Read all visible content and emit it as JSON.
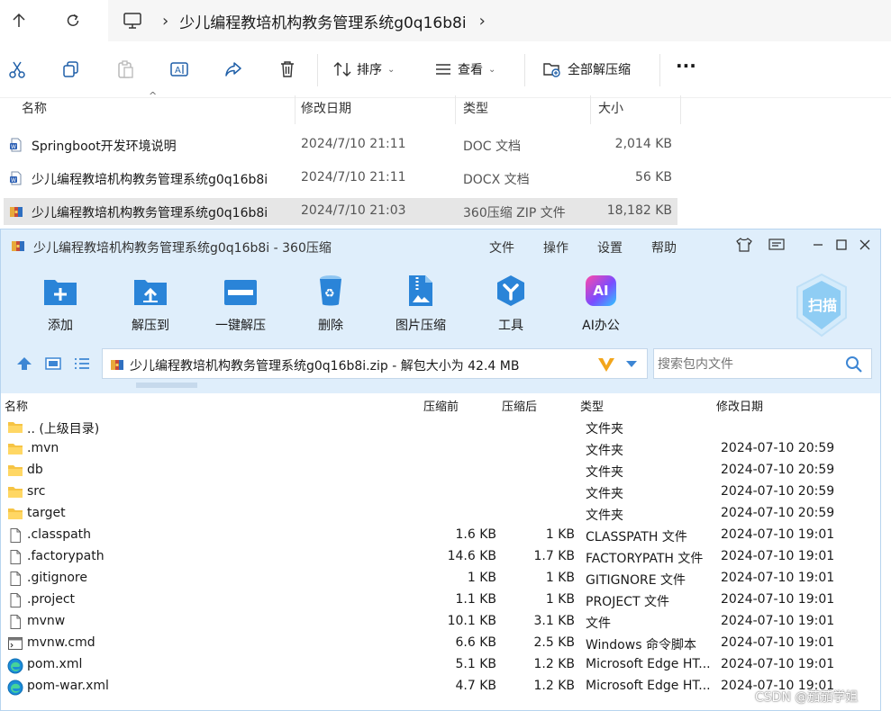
{
  "explorer": {
    "breadcrumb": "少儿编程教培机构教务管理系统g0q16b8i",
    "toolbar": {
      "sort_label": "排序",
      "view_label": "查看",
      "extract_all_label": "全部解压缩",
      "more_label": "···"
    },
    "columns": {
      "name": "名称",
      "date": "修改日期",
      "type": "类型",
      "size": "大小"
    },
    "files": [
      {
        "name": "Springboot开发环境说明",
        "date": "2024/7/10 21:11",
        "type": "DOC 文档",
        "size": "2,014 KB",
        "icon": "word-doc-icon"
      },
      {
        "name": "少儿编程教培机构教务管理系统g0q16b8i",
        "date": "2024/7/10 21:11",
        "type": "DOCX 文档",
        "size": "56 KB",
        "icon": "word-docx-icon"
      },
      {
        "name": "少儿编程教培机构教务管理系统g0q16b8i",
        "date": "2024/7/10 21:03",
        "type": "360压缩 ZIP 文件",
        "size": "18,182 KB",
        "icon": "zip-archive-icon"
      }
    ]
  },
  "zipwin": {
    "title": "少儿编程教培机构教务管理系统g0q16b8i - 360压缩",
    "menu": {
      "file": "文件",
      "ops": "操作",
      "settings": "设置",
      "help": "帮助"
    },
    "tools": {
      "add": "添加",
      "extract_to": "解压到",
      "one_click": "一键解压",
      "delete": "删除",
      "image_compress": "图片压缩",
      "tools": "工具",
      "ai_office": "AI办公"
    },
    "scan_label": "扫描",
    "ai_badge": "AI",
    "path_text": "少儿编程教培机构教务管理系统g0q16b8i.zip - 解包大小为 42.4 MB",
    "search_placeholder": "搜索包内文件",
    "columns": {
      "name": "名称",
      "before": "压缩前",
      "after": "压缩后",
      "type": "类型",
      "date": "修改日期"
    },
    "rows": [
      {
        "name": ".. (上级目录)",
        "before": "",
        "after": "",
        "type": "文件夹",
        "date": "",
        "icon": "folder-up-icon"
      },
      {
        "name": ".mvn",
        "before": "",
        "after": "",
        "type": "文件夹",
        "date": "2024-07-10 20:59",
        "icon": "folder-icon"
      },
      {
        "name": "db",
        "before": "",
        "after": "",
        "type": "文件夹",
        "date": "2024-07-10 20:59",
        "icon": "folder-icon"
      },
      {
        "name": "src",
        "before": "",
        "after": "",
        "type": "文件夹",
        "date": "2024-07-10 20:59",
        "icon": "folder-icon"
      },
      {
        "name": "target",
        "before": "",
        "after": "",
        "type": "文件夹",
        "date": "2024-07-10 20:59",
        "icon": "folder-icon"
      },
      {
        "name": ".classpath",
        "before": "1.6 KB",
        "after": "1 KB",
        "type": "CLASSPATH 文件",
        "date": "2024-07-10 19:01",
        "icon": "file-icon"
      },
      {
        "name": ".factorypath",
        "before": "14.6 KB",
        "after": "1.7 KB",
        "type": "FACTORYPATH 文件",
        "date": "2024-07-10 19:01",
        "icon": "file-icon"
      },
      {
        "name": ".gitignore",
        "before": "1 KB",
        "after": "1 KB",
        "type": "GITIGNORE 文件",
        "date": "2024-07-10 19:01",
        "icon": "file-icon"
      },
      {
        "name": ".project",
        "before": "1.1 KB",
        "after": "1 KB",
        "type": "PROJECT 文件",
        "date": "2024-07-10 19:01",
        "icon": "file-icon"
      },
      {
        "name": "mvnw",
        "before": "10.1 KB",
        "after": "3.1 KB",
        "type": "文件",
        "date": "2024-07-10 19:01",
        "icon": "file-icon"
      },
      {
        "name": "mvnw.cmd",
        "before": "6.6 KB",
        "after": "2.5 KB",
        "type": "Windows 命令脚本",
        "date": "2024-07-10 19:01",
        "icon": "cmd-script-icon"
      },
      {
        "name": "pom.xml",
        "before": "5.1 KB",
        "after": "1.2 KB",
        "type": "Microsoft Edge HT...",
        "date": "2024-07-10 19:01",
        "icon": "edge-icon"
      },
      {
        "name": "pom-war.xml",
        "before": "4.7 KB",
        "after": "1.2 KB",
        "type": "Microsoft Edge HT...",
        "date": "2024-07-10 19:01",
        "icon": "edge-icon"
      }
    ]
  },
  "watermark": "CSDN @茄茄学姐"
}
